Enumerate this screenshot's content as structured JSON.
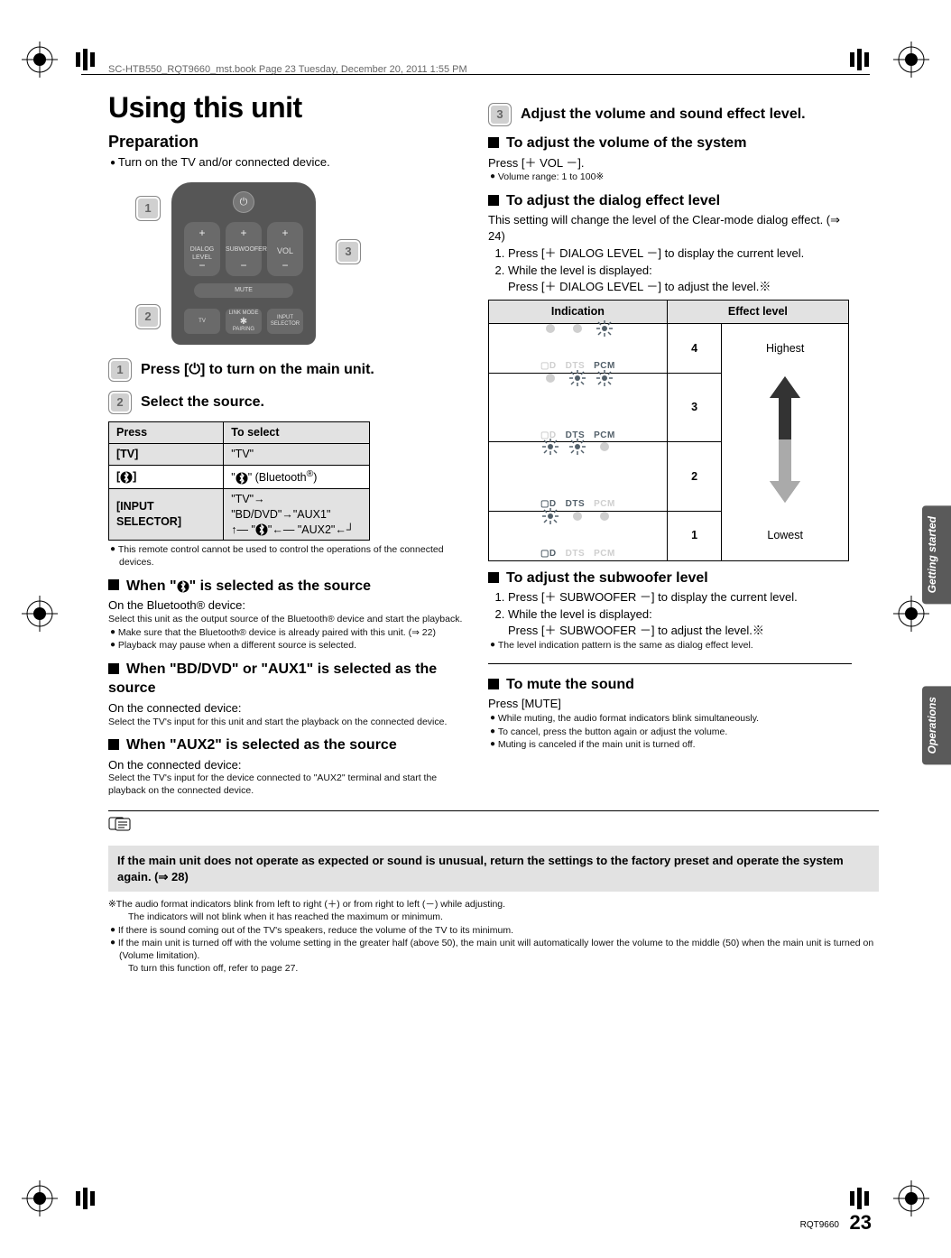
{
  "header_line": "SC-HTB550_RQT9660_mst.book  Page 23  Tuesday, December 20, 2011  1:55 PM",
  "title": "Using this unit",
  "preparation_heading": "Preparation",
  "preparation_bullet": "Turn on the TV and/or connected device.",
  "remote": {
    "dialog": "DIALOG LEVEL",
    "sub": "SUBWOOFER",
    "vol": "VOL",
    "mute": "MUTE",
    "tv": "TV",
    "link": "LINK MODE",
    "pairing": "PAIRING",
    "input": "INPUT SELECTOR"
  },
  "step1": "Press [⏻] to turn on the main unit.",
  "step2": "Select the source.",
  "press_table": {
    "h1": "Press",
    "h2": "To select",
    "r1a": "[TV]",
    "r1b": "\"TV\"",
    "r2a": "[  ]",
    "r2b": "\"   \" (Bluetooth®)",
    "r3a": "[INPUT SELECTOR]",
    "r3b_top": "\"TV\"→ \"BD/DVD\"→\"AUX1\"",
    "r3b_bot": "↑— \"   \"←— \"AUX2\"←┘"
  },
  "remote_note": "This remote control cannot be used to control the operations of the connected devices.",
  "when_bt_heading": "When \"   \" is selected as the source",
  "when_bt_line1": "On the Bluetooth® device:",
  "when_bt_line2": "Select this unit as the output source of the Bluetooth® device and start the playback.",
  "when_bt_b1": "Make sure that the Bluetooth® device is already paired with this unit. (⇒ 22)",
  "when_bt_b2": "Playback may pause when a different source is selected.",
  "when_bddvd_heading": "When \"BD/DVD\" or \"AUX1\" is selected as the source",
  "when_bddvd_line1": "On the connected device:",
  "when_bddvd_line2": "Select the TV's input for this unit and start the playback on the connected device.",
  "when_aux2_heading": "When \"AUX2\" is selected as the source",
  "when_aux2_line1": "On the connected device:",
  "when_aux2_line2": "Select the TV's input for the device connected to \"AUX2\" terminal and start the playback on the connected device.",
  "step3": "Adjust the volume and sound effect level.",
  "vol_heading": "To adjust the volume of the system",
  "vol_line": "Press [＋ VOL －].",
  "vol_range": "Volume range: 1 to 100※",
  "dialog_heading": "To adjust the dialog effect level",
  "dialog_intro": "This setting will change the level of the Clear-mode dialog effect. (⇒ 24)",
  "dialog_step1": "Press [＋ DIALOG LEVEL －] to display the current level.",
  "dialog_step2a": "While the level is displayed:",
  "dialog_step2b": "Press [＋ DIALOG LEVEL －] to adjust the level.※",
  "effect_table": {
    "h1": "Indication",
    "h2": "Effect level",
    "r1n": "4",
    "r1t": "Highest",
    "r2n": "3",
    "r3n": "2",
    "r4n": "1",
    "r4t": "Lowest",
    "dd": "D",
    "dts": "DTS",
    "pcm": "PCM"
  },
  "sub_heading": "To adjust the subwoofer level",
  "sub_step1": "Press [＋ SUBWOOFER －] to display the current level.",
  "sub_step2a": "While the level is displayed:",
  "sub_step2b": "Press [＋ SUBWOOFER －] to adjust the level.※",
  "sub_note": "The level indication pattern is the same as dialog effect level.",
  "mute_heading": "To mute the sound",
  "mute_line": "Press [MUTE]",
  "mute_b1": "While muting, the audio format indicators blink simultaneously.",
  "mute_b2": "To cancel, press the button again or adjust the volume.",
  "mute_b3": "Muting is canceled if the main unit is turned off.",
  "tab1": "Getting started",
  "tab2": "Operations",
  "footnote_box": "If the main unit does not operate as expected or sound is unusual, return the settings to the factory preset and operate the system again. (⇒ 28)",
  "foot1a": "※The audio format indicators blink from left to right (＋) or from right to left (－) while adjusting.",
  "foot1b": "The indicators will not blink when it has reached the maximum or minimum.",
  "foot2": "If there is sound coming out of the TV's speakers, reduce the volume of the TV to its minimum.",
  "foot3a": "If the main unit is turned off with the volume setting in the greater half (above 50), the main unit will automatically lower the volume to the middle (50) when the main unit is turned on (Volume limitation).",
  "foot3b": "To turn this function off, refer to page 27.",
  "rqt": "RQT9660",
  "page_num": "23"
}
